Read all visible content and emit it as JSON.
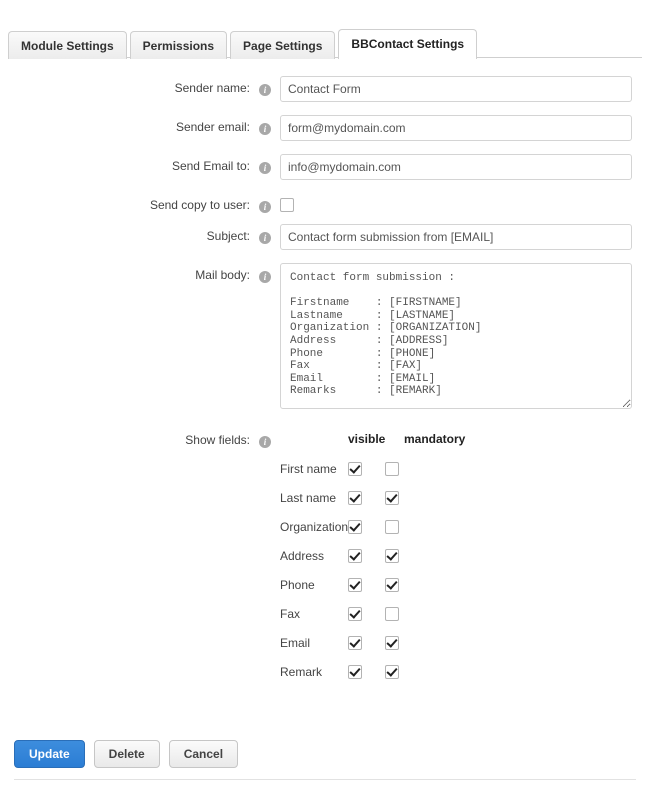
{
  "tabs": [
    {
      "label": "Module Settings",
      "active": false
    },
    {
      "label": "Permissions",
      "active": false
    },
    {
      "label": "Page Settings",
      "active": false
    },
    {
      "label": "BBContact Settings",
      "active": true
    }
  ],
  "icons": {
    "info": "i",
    "info_name": "info-icon"
  },
  "form": {
    "sender_name": {
      "label": "Sender name:",
      "value": "Contact Form"
    },
    "sender_email": {
      "label": "Sender email:",
      "value": "form@mydomain.com"
    },
    "send_email_to": {
      "label": "Send Email to:",
      "value": "info@mydomain.com"
    },
    "send_copy_to_user": {
      "label": "Send copy to user:",
      "checked": false
    },
    "subject": {
      "label": "Subject:",
      "value": "Contact form submission from [EMAIL]"
    },
    "mail_body": {
      "label": "Mail body:",
      "value": "Contact form submission :\n\nFirstname    : [FIRSTNAME]\nLastname     : [LASTNAME]\nOrganization : [ORGANIZATION]\nAddress      : [ADDRESS]\nPhone        : [PHONE]\nFax          : [FAX]\nEmail        : [EMAIL]\nRemarks      : [REMARK]"
    },
    "show_fields": {
      "label": "Show fields:",
      "columns": {
        "visible": "visible",
        "mandatory": "mandatory"
      },
      "rows": [
        {
          "label": "First name",
          "visible": true,
          "mandatory": false
        },
        {
          "label": "Last name",
          "visible": true,
          "mandatory": true
        },
        {
          "label": "Organization",
          "visible": true,
          "mandatory": false
        },
        {
          "label": "Address",
          "visible": true,
          "mandatory": true
        },
        {
          "label": "Phone",
          "visible": true,
          "mandatory": true
        },
        {
          "label": "Fax",
          "visible": true,
          "mandatory": false
        },
        {
          "label": "Email",
          "visible": true,
          "mandatory": true
        },
        {
          "label": "Remark",
          "visible": true,
          "mandatory": true
        }
      ]
    }
  },
  "buttons": {
    "update": "Update",
    "delete": "Delete",
    "cancel": "Cancel"
  },
  "colors": {
    "primary": "#2b7dd4",
    "border": "#d4d4d4",
    "tab_border": "#cfcfcf",
    "info_icon": "#a8a8a8"
  }
}
